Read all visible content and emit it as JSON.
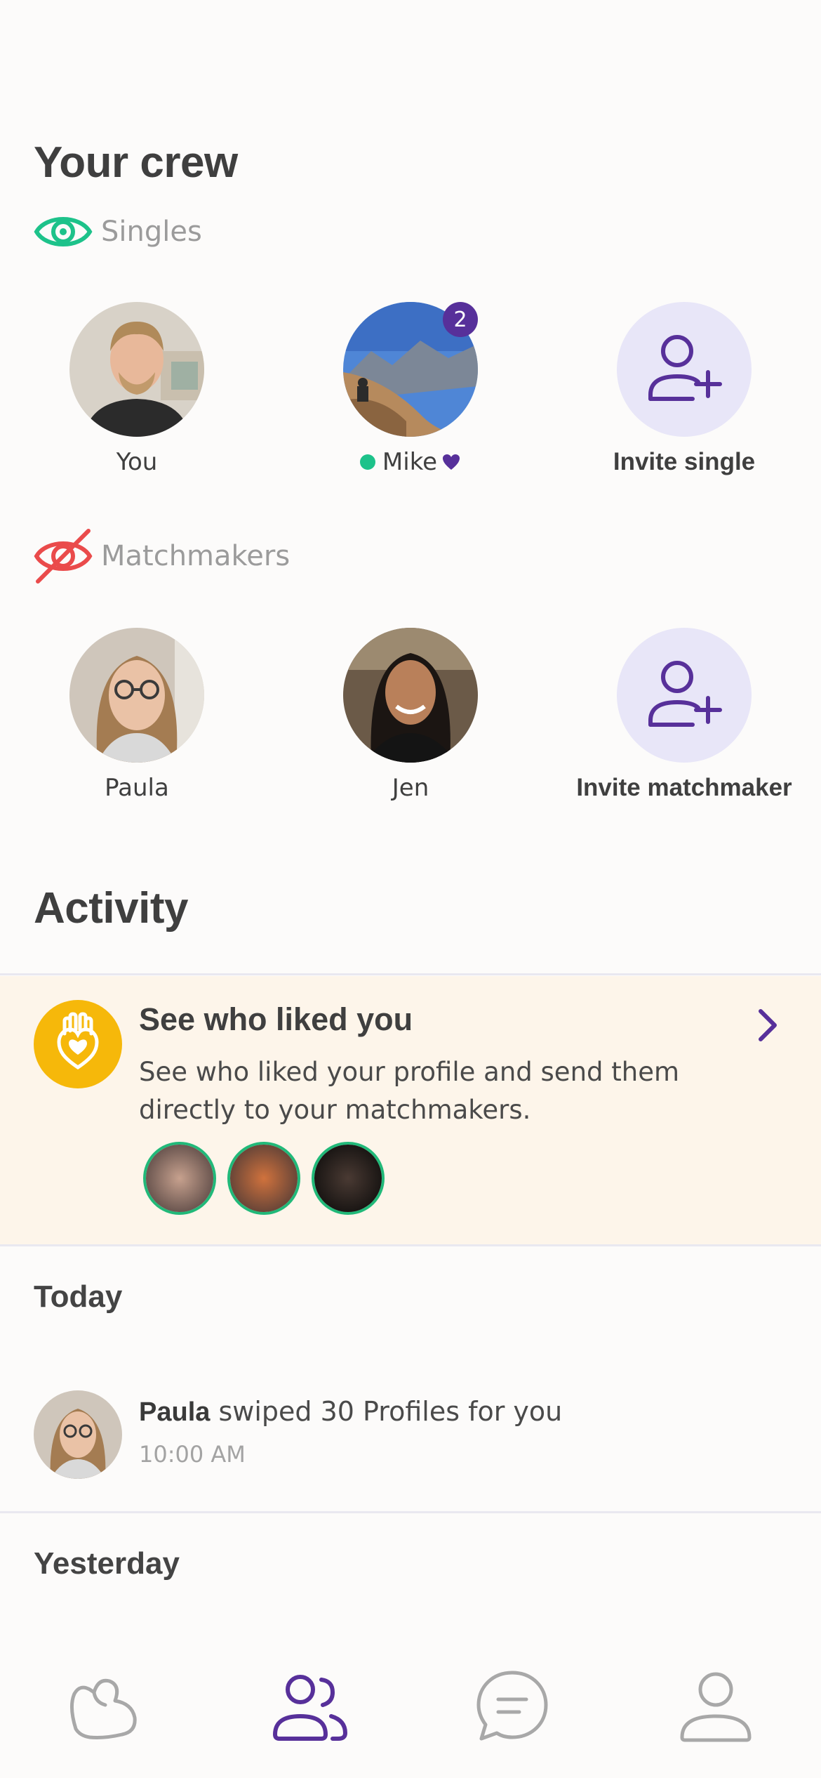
{
  "crew": {
    "title": "Your crew",
    "singles_label": "Singles",
    "matchmakers_label": "Matchmakers",
    "singles": [
      {
        "name": "You"
      },
      {
        "name": "Mike",
        "badge": "2",
        "online": true
      },
      {
        "name": "Invite single",
        "invite": true
      }
    ],
    "matchmakers": [
      {
        "name": "Paula"
      },
      {
        "name": "Jen"
      },
      {
        "name": "Invite matchmaker",
        "invite": true
      }
    ]
  },
  "activity": {
    "title": "Activity",
    "liked_card": {
      "title": "See who liked you",
      "description": "See who liked your profile and send them directly to your matchmakers."
    },
    "today_label": "Today",
    "today_items": [
      {
        "actor": "Paula",
        "text": " swiped 30 Profiles for you",
        "time": "10:00 AM"
      }
    ],
    "yesterday_label": "Yesterday"
  },
  "tabbar": {
    "tabs": [
      {
        "icon": "heart-hand-icon",
        "active": false
      },
      {
        "icon": "crew-icon",
        "active": true
      },
      {
        "icon": "chat-icon",
        "active": false
      },
      {
        "icon": "profile-icon",
        "active": false
      }
    ]
  },
  "colors": {
    "accent": "#57309a",
    "online": "#1dc28a",
    "card_bg": "#fdf5ea",
    "liked_icon_bg": "#f6b80a",
    "invite_bg": "#e8e6f8"
  }
}
